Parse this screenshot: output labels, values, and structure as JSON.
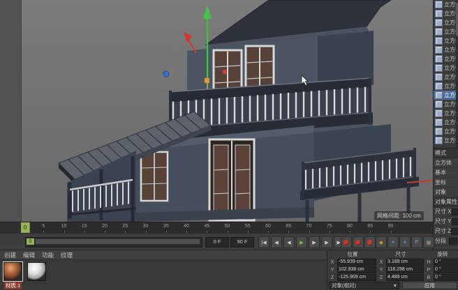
{
  "viewport": {
    "grid_label": "网格间距: 100 cm"
  },
  "object_manager": {
    "items": [
      {
        "label": "立方体",
        "selected": false
      },
      {
        "label": "立方体",
        "selected": false
      },
      {
        "label": "立方体",
        "selected": false
      },
      {
        "label": "立方体",
        "selected": false
      },
      {
        "label": "立方体",
        "selected": false
      },
      {
        "label": "立方体",
        "selected": false
      },
      {
        "label": "立方体",
        "selected": false
      },
      {
        "label": "立方体",
        "selected": false
      },
      {
        "label": "立方体",
        "selected": false
      },
      {
        "label": "立方体",
        "selected": false
      },
      {
        "label": "立方体",
        "selected": true
      },
      {
        "label": "立方体",
        "selected": false
      },
      {
        "label": "立方体",
        "selected": false
      },
      {
        "label": "立方体",
        "selected": false
      },
      {
        "label": "立方体",
        "selected": false
      },
      {
        "label": "立方体",
        "selected": false
      }
    ]
  },
  "attributes": {
    "rows": [
      {
        "label": "模式",
        "header": true
      },
      {
        "label": "立方体"
      },
      {
        "label": "基本"
      },
      {
        "label": "坐标"
      },
      {
        "label": "对象"
      },
      {
        "label": "对象属性",
        "header": true
      },
      {
        "label": "尺寸 X",
        "has_value": true
      },
      {
        "label": "尺寸 Y",
        "has_value": true
      },
      {
        "label": "尺寸 Z",
        "has_value": true
      },
      {
        "label": "分段",
        "has_value": true
      }
    ]
  },
  "timeline": {
    "playhead": "0",
    "start": "0 F",
    "end": "90 F",
    "ticks": [
      "5",
      "10",
      "15",
      "20",
      "25",
      "30",
      "35",
      "40",
      "45",
      "50",
      "55",
      "60",
      "65",
      "70",
      "75",
      "80",
      "85",
      "90"
    ],
    "transport": [
      {
        "name": "goto-start",
        "glyph": "|◀"
      },
      {
        "name": "previous-key",
        "glyph": "◀"
      },
      {
        "name": "previous-frame",
        "glyph": "◀"
      },
      {
        "name": "play",
        "glyph": "▶",
        "accent": true
      },
      {
        "name": "next-frame",
        "glyph": "▶"
      },
      {
        "name": "next-key",
        "glyph": "▶"
      },
      {
        "name": "goto-end",
        "glyph": "▶|"
      }
    ],
    "record": [
      {
        "name": "record-keyframe"
      },
      {
        "name": "record-autokey"
      },
      {
        "name": "record-options"
      }
    ],
    "extras": [
      {
        "name": "key-position",
        "glyph": "◆",
        "color": "#d89c3a"
      },
      {
        "name": "key-scale",
        "glyph": "●",
        "color": "#4f8fd0"
      },
      {
        "name": "key-rotation",
        "glyph": "●",
        "color": "#4f8fd0"
      },
      {
        "name": "key-parameter",
        "glyph": "P",
        "color": "#74a8e0"
      },
      {
        "name": "key-pla",
        "glyph": "▦",
        "color": "#9aa0a6"
      }
    ]
  },
  "materials": {
    "tabs": [
      "创建",
      "编辑",
      "功能",
      "纹理"
    ],
    "selected_material": "材质.1"
  },
  "coordinates": {
    "headers": [
      "位置",
      "尺寸",
      "旋转"
    ],
    "rows": [
      {
        "pos_axis": "X",
        "pos": "-55.939 cm",
        "size_axis": "X",
        "size": "3.189 cm",
        "rot_axis": "H",
        "rot": "0 °"
      },
      {
        "pos_axis": "Y",
        "pos": "102.938 cm",
        "size_axis": "Y",
        "size": "118.298 cm",
        "rot_axis": "P",
        "rot": "0 °"
      },
      {
        "pos_axis": "Z",
        "pos": "-125.909 cm",
        "size_axis": "Z",
        "size": "4.489 cm",
        "rot_axis": "B",
        "rot": "0 °"
      }
    ],
    "space_dropdown": "对象(相对)",
    "dropdown_arrow": "▾",
    "apply_button": "应用"
  },
  "colors": {
    "accent_green": "#46c44a",
    "accent_red": "#c53a2c",
    "selection_blue": "#4a6d9b",
    "playhead_green": "#95b45a"
  }
}
